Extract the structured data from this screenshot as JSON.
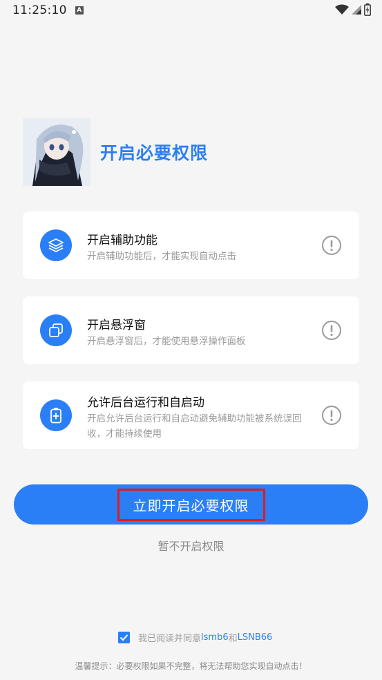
{
  "status_bar": {
    "time": "11:25:10",
    "badge": "A"
  },
  "header": {
    "title": "开启必要权限"
  },
  "permissions": [
    {
      "icon": "layers-icon",
      "title": "开启辅助功能",
      "desc": "开启辅助功能后，才能实现自动点击"
    },
    {
      "icon": "overlay-windows-icon",
      "title": "开启悬浮窗",
      "desc": "开启悬浮窗后，才能使用悬浮操作面板"
    },
    {
      "icon": "battery-plus-icon",
      "title": "允许后台运行和自启动",
      "desc": "开启允许后台运行和自启动避免辅助功能被系统误回收，才能持续使用"
    }
  ],
  "actions": {
    "primary": "立即开启必要权限",
    "secondary": "暂不开启权限"
  },
  "agreement": {
    "checked": true,
    "prefix": "我已阅读并同意",
    "link1": "lsmb6",
    "joiner": "和",
    "link2": "LSNB66"
  },
  "tip": "温馨提示：必要权限如果不完整，将无法帮助您实现自动点击！",
  "colors": {
    "accent": "#2b7ff6",
    "highlight_border": "#e11b1b",
    "background": "#f5f5f5"
  }
}
